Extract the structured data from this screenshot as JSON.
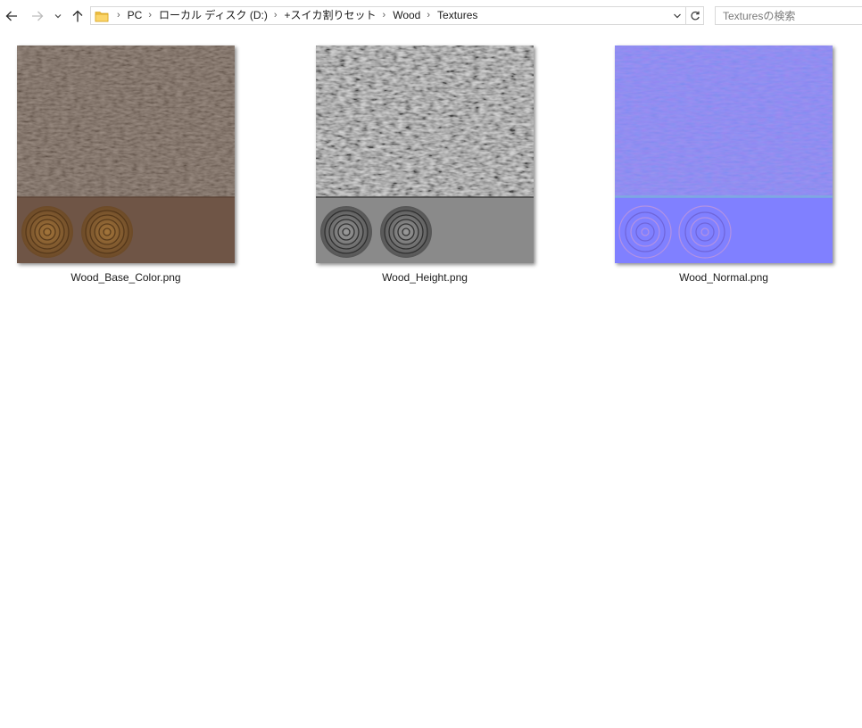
{
  "navigation": {
    "back_icon": "arrow-left-icon",
    "forward_icon": "arrow-right-icon",
    "recent_icon": "chevron-down-icon",
    "up_icon": "arrow-up-icon",
    "refresh_icon": "refresh-icon"
  },
  "address_bar": {
    "folder_icon": "folder-icon",
    "breadcrumb": [
      "PC",
      "ローカル ディスク (D:)",
      "+スイカ割りセット",
      "Wood",
      "Textures"
    ]
  },
  "search": {
    "placeholder": "Texturesの検索"
  },
  "files": [
    {
      "name": "Wood_Base_Color.png",
      "kind": "base_color",
      "top_color": "#6e5a4c",
      "bottom_color": "#6f5546"
    },
    {
      "name": "Wood_Height.png",
      "kind": "height",
      "top_color": "#9a9a9a",
      "bottom_color": "#8a8a8a"
    },
    {
      "name": "Wood_Normal.png",
      "kind": "normal",
      "top_color": "#8583f0",
      "bottom_color": "#8080ff"
    }
  ]
}
